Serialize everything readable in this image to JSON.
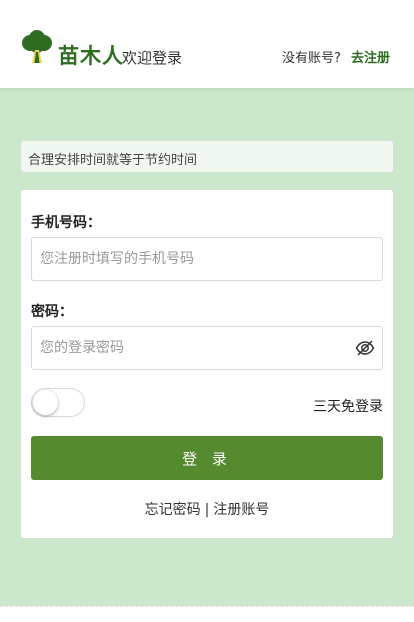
{
  "header": {
    "brand": "苗木人",
    "welcome": "欢迎登录",
    "no_account": "没有账号?",
    "register": "去注册",
    "logo_icon": "tree-logo-icon"
  },
  "tip": "合理安排时间就等于节约时间",
  "form": {
    "phone_label": "手机号码：",
    "phone_placeholder": "您注册时填写的手机号码",
    "phone_value": "",
    "password_label": "密码：",
    "password_placeholder": "您的登录密码",
    "password_value": "",
    "eye_icon": "eye-off-icon",
    "remember_label": "三天免登录",
    "remember_on": false,
    "login_button": "登 录",
    "forgot_link": "忘记密码",
    "separator": "|",
    "register_link": "注册账号"
  },
  "colors": {
    "background": "#cce7cc",
    "brand": "#2e6d22",
    "button": "#568a2e"
  }
}
